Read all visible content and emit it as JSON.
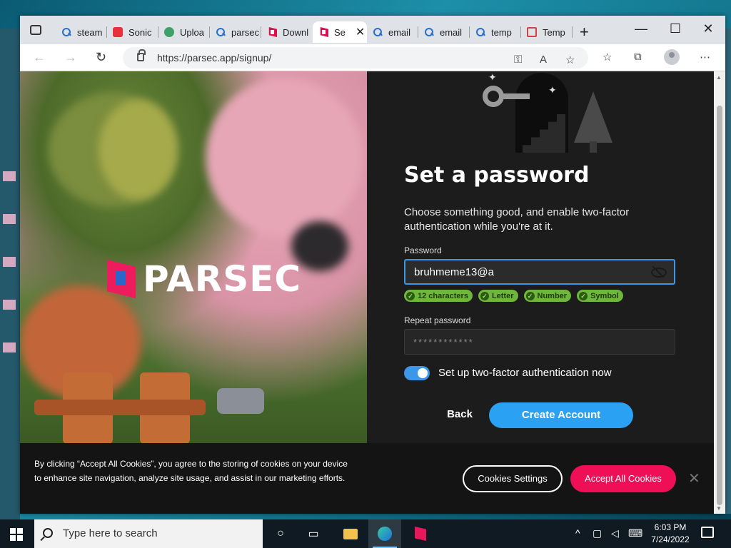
{
  "browser": {
    "tabs": [
      {
        "title": "steam",
        "icon": "search-icon"
      },
      {
        "title": "Sonic",
        "icon": "roblox-icon"
      },
      {
        "title": "Uploa",
        "icon": "upload-icon"
      },
      {
        "title": "parsec",
        "icon": "search-icon"
      },
      {
        "title": "Downl",
        "icon": "parsec-icon"
      },
      {
        "title": "Se",
        "icon": "parsec-icon",
        "active": true
      },
      {
        "title": "email",
        "icon": "search-icon"
      },
      {
        "title": "email",
        "icon": "search-icon"
      },
      {
        "title": "temp",
        "icon": "search-icon"
      },
      {
        "title": "Temp",
        "icon": "mail-icon"
      }
    ],
    "close_tab_glyph": "✕",
    "new_tab_glyph": "+",
    "minimize_glyph": "—",
    "maximize_glyph": "☐",
    "close_glyph": "✕",
    "url": "https://parsec.app/signup/",
    "more_glyph": "⋯"
  },
  "hero": {
    "logo_text": "PARSEC"
  },
  "form": {
    "title": "Set a password",
    "description": "Choose something good, and enable two-factor authentication while you're at it.",
    "password_label": "Password",
    "password_value": "bruhmeme13@a",
    "requirements": [
      "12 characters",
      "Letter",
      "Number",
      "Symbol"
    ],
    "repeat_label": "Repeat password",
    "repeat_value": "************",
    "two_factor_label": "Set up two-factor authentication now",
    "two_factor_enabled": true,
    "back_label": "Back",
    "create_label": "Create Account"
  },
  "cookies": {
    "text": "By clicking “Accept All Cookies”, you agree to the storing of cookies on your device to enhance site navigation, analyze site usage, and assist in our marketing efforts.",
    "settings_label": "Cookies Settings",
    "accept_label": "Accept All Cookies",
    "close_glyph": "✕"
  },
  "taskbar": {
    "search_placeholder": "Type here to search",
    "time": "6:03 PM",
    "date": "7/24/2022"
  },
  "colors": {
    "accent_blue": "#2aa1f2",
    "accept_pink": "#ee0f56",
    "check_green": "#6fb63d"
  }
}
